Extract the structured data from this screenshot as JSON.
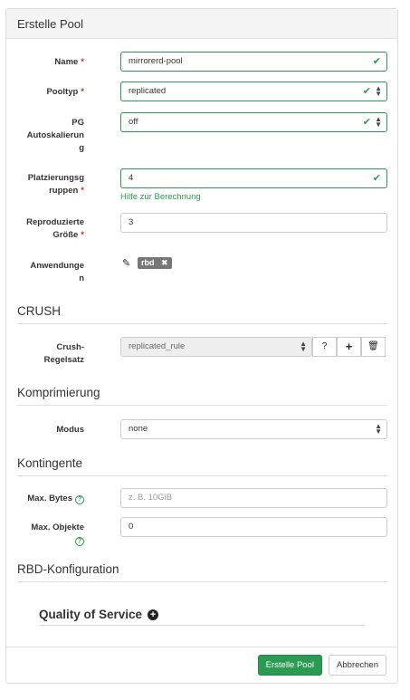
{
  "header": {
    "title": "Erstelle Pool"
  },
  "fields": {
    "name": {
      "label": "Name",
      "value": "mirrorerd-pool"
    },
    "pooltype": {
      "label": "Pooltyp",
      "value": "replicated"
    },
    "pg_autoscale": {
      "label_l1": "PG",
      "label_l2": "Autoskalierun",
      "label_l3": "g",
      "value": "off"
    },
    "pg_count": {
      "label_l1": "Platzierungsg",
      "label_l2": "ruppen",
      "value": "4",
      "help": "Hilfe zur Berechnung"
    },
    "replicated_size": {
      "label_l1": "Reproduzierte",
      "label_l2": "Größe",
      "value": "3"
    },
    "applications": {
      "label_l1": "Anwendunge",
      "label_l2": "n",
      "tag": "rbd"
    }
  },
  "crush": {
    "title": "CRUSH",
    "ruleset": {
      "label_l1": "Crush-",
      "label_l2": "Regelsatz",
      "value": "replicated_rule"
    }
  },
  "compression": {
    "title": "Komprimierung",
    "mode": {
      "label": "Modus",
      "value": "none"
    }
  },
  "quotas": {
    "title": "Kontingente",
    "max_bytes": {
      "label": "Max. Bytes",
      "placeholder": "z. B. 10GiB"
    },
    "max_objects": {
      "label": "Max. Objekte",
      "value": "0"
    }
  },
  "rbd": {
    "title": "RBD-Konfiguration",
    "qos_title": "Quality of Service"
  },
  "footer": {
    "submit_label": "Erstelle Pool",
    "cancel_label": "Abbrechen"
  },
  "colors": {
    "accent": "#2b9a52",
    "required": "#c9302c"
  },
  "icons": [
    "check-icon",
    "sort-arrows-icon",
    "pencil-icon",
    "remove-icon",
    "help-icon",
    "plus-icon",
    "trash-icon",
    "plus-circle-icon"
  ]
}
